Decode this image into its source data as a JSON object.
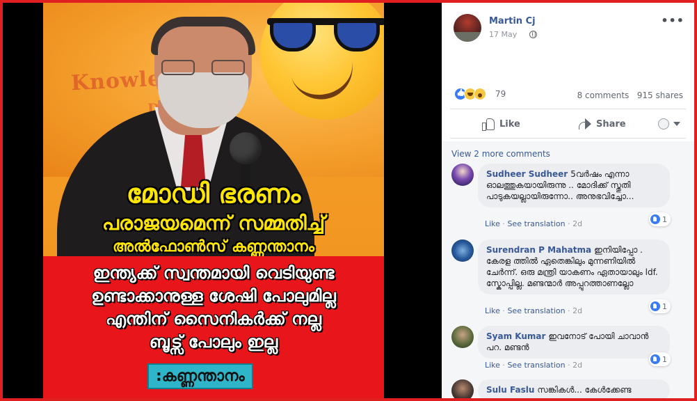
{
  "image": {
    "headline_line1": "മോഡി ഭരണം",
    "headline_line2": "പരാജയമെന്ന് സമ്മതിച്ച്",
    "headline_line3": "അൽഫോൺസ് കണ്ണന്താനം",
    "body_lines": [
      "ഇന്ത്യക്ക് സ്വന്തമായി വെടിയുണ്ട",
      "ഉണ്ടാക്കാനുള്ള ശേഷി പോലുമില്ല",
      "എന്തിന് സൈനികർക്ക് നല്ല",
      "ബൂട്സ് പോലും ഇല്ല"
    ],
    "tag": ":കണ്ണന്താനം",
    "watermark": "Knowle",
    "watermark2": "Del"
  },
  "post": {
    "author": "Martin Cj",
    "date": "17 May",
    "more": "•••",
    "reaction_count": "79",
    "comments_count": "8 comments",
    "shares_count": "915 shares"
  },
  "actions": {
    "like": "Like",
    "share": "Share"
  },
  "comments_section": {
    "view_more": "View 2 more comments",
    "comments": [
      {
        "name": "Sudheer Sudheer",
        "text": "5വർഷം എന്നാ ഓലത്തുകയായിരുന്നു .. മോദിക്ക് സ്തുതി പാടുകയല്ലായിരുന്നോ.. അനുഭവിച്ചോ...",
        "like": "Like",
        "translate": "See translation",
        "age": "2d",
        "reactions": "1"
      },
      {
        "name": "Surendran P Mahatma",
        "text": "ഇനിയിപ്പോ . കേരള ത്തിൽ ഏതെങ്കിലും മുന്നണിയിൽ ചേർന്ന്. ഒരു മന്ത്രി യാകണം ഏതായാലും ldf. സ്കോപ്പില്ല. മണ്ടന്മാർ അപ്പുറത്താണല്ലോ",
        "like": "Like",
        "translate": "See translation",
        "age": "2d",
        "reactions": "1"
      },
      {
        "name": "Syam Kumar",
        "text": "ഇവനോട് പോയി ചാവാൻ പറ. മണ്ടൻ",
        "like": "Like",
        "translate": "See translation",
        "age": "2d",
        "reactions": "1"
      },
      {
        "name": "Sulu Faslu",
        "text": "സങ്കികൾ... കേൾക്കേണ്ട"
      }
    ]
  },
  "colors": {
    "border": "#e02020",
    "link_blue": "#385898",
    "headline_yellow": "#ffe600",
    "red_box": "#e8151b"
  }
}
